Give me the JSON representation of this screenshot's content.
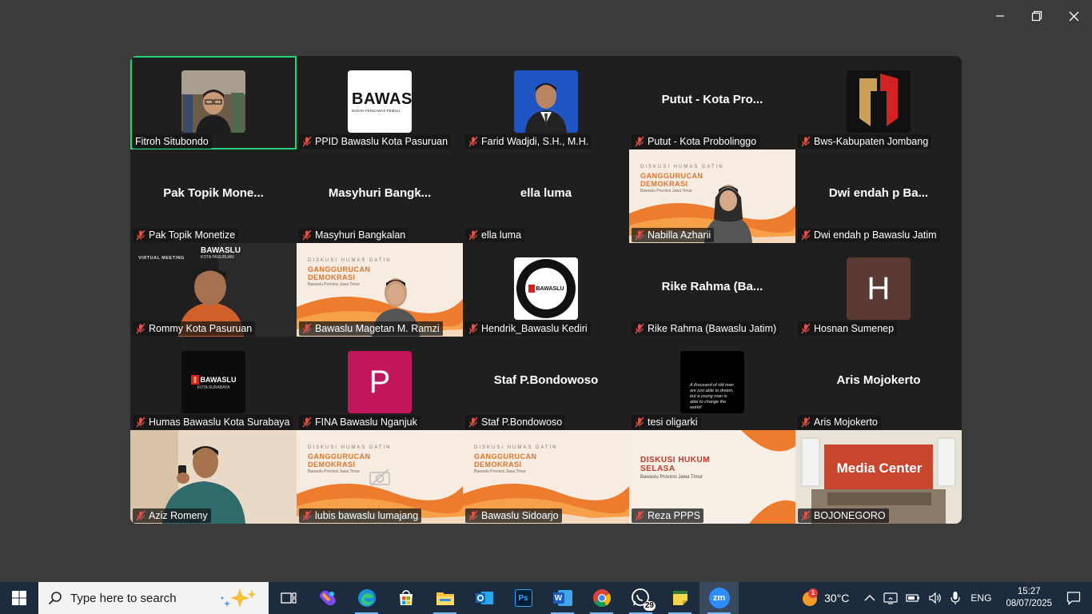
{
  "window": {
    "controls": [
      "minimize",
      "restore",
      "close"
    ]
  },
  "participants": [
    {
      "name": "Fitroh Situbondo",
      "muted": false,
      "active_speaker": true,
      "visual": "photo-person"
    },
    {
      "name": "PPID Bawaslu Kota Pasuruan",
      "muted": true,
      "visual": "bawaslu-logo-card",
      "logo_text": "BAWAS",
      "logo_subtext": "BADAN PENGAWAS PEMILU"
    },
    {
      "name": "Farid Wadjdi, S.H., M.H.",
      "muted": true,
      "visual": "photo-portrait"
    },
    {
      "name": "Putut - Kota Probolinggo",
      "display_name": "Putut - Kota Pro...",
      "muted": true,
      "visual": "name-only"
    },
    {
      "name": "Bws-Kabupaten Jombang",
      "muted": true,
      "visual": "bawaslu-emblem"
    },
    {
      "name": "Pak Topik Monetize",
      "display_name": "Pak Topik Mone...",
      "muted": true,
      "visual": "name-only"
    },
    {
      "name": "Masyhuri Bangkalan",
      "display_name": "Masyhuri  Bangk...",
      "muted": true,
      "visual": "name-only"
    },
    {
      "name": "ella luma",
      "display_name": "ella luma",
      "muted": true,
      "visual": "name-only"
    },
    {
      "name": "Nabilla Azharii",
      "muted": true,
      "visual": "video-banner-person",
      "banner_small": "DISKUSI HUMAS DATIN",
      "banner_title": "GANGGURUCAN DEMOKRASI",
      "banner_sub": "Bawaslu Provinsi Jawa Timur"
    },
    {
      "name": "Dwi endah p Bawaslu Jatim",
      "display_name": "Dwi endah p Ba...",
      "muted": true,
      "visual": "name-only"
    },
    {
      "name": "Rommy Kota Pasuruan",
      "muted": true,
      "visual": "video-virtual-bg",
      "banner_small": "VIRTUAL MEETING",
      "logo_text": "BAWASLU",
      "logo_subtext": "KOTA PASURUAN"
    },
    {
      "name": "Bawaslu Magetan M. Ramzi",
      "muted": true,
      "visual": "video-banner-person",
      "banner_small": "DISKUSI HUMAS DATIN",
      "banner_title": "GANGGURUCAN DEMOKRASI",
      "banner_sub": "Bawaslu Provinsi Jawa Timur"
    },
    {
      "name": "Hendrik_Bawaslu Kediri",
      "muted": true,
      "visual": "bawaslu-round-logo",
      "logo_text": "BAWASLU"
    },
    {
      "name": "Rike Rahma (Bawaslu Jatim)",
      "display_name": "Rike Rahma (Ba...",
      "muted": true,
      "visual": "name-only"
    },
    {
      "name": "Hosnan Sumenep",
      "muted": true,
      "visual": "letter-avatar",
      "letter": "H"
    },
    {
      "name": "Humas Bawaslu Kota Surabaya",
      "muted": true,
      "visual": "bawaslu-dark-card",
      "logo_text": "BAWASLU",
      "logo_subtext": "KOTA SURABAYA"
    },
    {
      "name": "FINA Bawaslu Nganjuk",
      "muted": true,
      "visual": "letter-avatar",
      "letter": "P"
    },
    {
      "name": "Staf P.Bondowoso",
      "display_name": "Staf P.Bondowoso",
      "muted": true,
      "visual": "name-only"
    },
    {
      "name": "tesi oligarki",
      "muted": true,
      "visual": "quote-card",
      "quote": "A thousand of old man are just able to dream, but a young man is able to change the world!"
    },
    {
      "name": "Aris Mojokerto",
      "display_name": "Aris Mojokerto",
      "muted": true,
      "visual": "name-only"
    },
    {
      "name": "Aziz Romeny",
      "muted": true,
      "visual": "video-person"
    },
    {
      "name": "lubis bawaslu lumajang",
      "muted": true,
      "visual": "video-banner-camera-off",
      "banner_small": "DISKUSI HUMAS DATIN",
      "banner_title": "GANGGURUCAN DEMOKRASI",
      "banner_sub": "Bawaslu Provinsi Jawa Timur"
    },
    {
      "name": "Bawaslu Sidoarjo",
      "muted": true,
      "visual": "video-banner",
      "banner_small": "DISKUSI HUMAS DATIN",
      "banner_title": "GANGGURUCAN DEMOKRASI",
      "banner_sub": "Bawaslu Provinsi Jawa Timur"
    },
    {
      "name": "Reza PPPS",
      "muted": true,
      "visual": "video-banner-hukum",
      "banner_title": "DISKUSI HUKUM SELASA",
      "banner_sub": "Bawaslu Provinsi Jawa Timur"
    },
    {
      "name": "BOJONEGORO",
      "muted": true,
      "visual": "video-room",
      "room_text": "Media Center"
    }
  ],
  "taskbar": {
    "search_placeholder": "Type here to search",
    "apps": [
      {
        "icon": "task-view-icon"
      },
      {
        "icon": "copilot-icon"
      },
      {
        "icon": "edge-icon"
      },
      {
        "icon": "store-icon"
      },
      {
        "icon": "file-explorer-icon"
      },
      {
        "icon": "outlook-icon"
      },
      {
        "icon": "photoshop-icon",
        "label": "Ps"
      },
      {
        "icon": "word-icon",
        "label": "W"
      },
      {
        "icon": "chrome-icon"
      },
      {
        "icon": "whatsapp-icon",
        "badge": "29"
      },
      {
        "icon": "sticky-notes-icon"
      },
      {
        "icon": "zoom-icon",
        "label": "zm",
        "active": true
      }
    ],
    "weather": {
      "temp": "30°C",
      "alert_badge": "1"
    },
    "language": "ENG",
    "time": "15:27",
    "date": "08/07/2025"
  },
  "colors": {
    "background": "#3b3b3b",
    "grid": "#1f1f1f",
    "active_border": "#27d17c",
    "mute_icon": "#e0504a",
    "taskbar": "#1c2b3d",
    "hosnan_avatar": "#5b3a33",
    "fina_avatar": "#c2185b",
    "banner_orange": "#e0742b"
  }
}
